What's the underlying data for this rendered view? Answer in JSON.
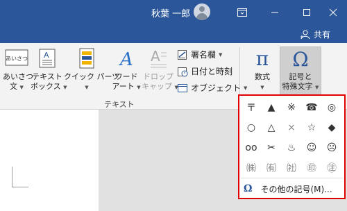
{
  "titlebar": {
    "user_name": "秋葉 一郎"
  },
  "sharebar": {
    "share_label": "共有"
  },
  "ribbon": {
    "buttons": {
      "greeting": [
        "あいさつ",
        "文"
      ],
      "textbox": [
        "テキスト",
        "ボックス"
      ],
      "quickparts": [
        "クイック パーツ"
      ],
      "wordart": [
        "ワード",
        "アート"
      ],
      "dropcap": [
        "ドロップ",
        "キャップ"
      ],
      "equation": [
        "数式"
      ],
      "symbol": [
        "記号と",
        "特殊文字"
      ]
    },
    "greeting_icon_text": "あいさつ",
    "small": {
      "signature": "署名欄",
      "datetime": "日付と時刻",
      "object": "オブジェクト"
    },
    "group_label": "テキスト"
  },
  "dropdown": {
    "symbols": [
      [
        "〒",
        "▲",
        "※",
        "☎",
        "◎"
      ],
      [
        "○",
        "△",
        "×",
        "☆",
        "◆"
      ],
      [
        "oo",
        "✂",
        "♨",
        "☺",
        "☹"
      ],
      [
        "㈱",
        "㈲",
        "㈳",
        "㊞",
        "㊟"
      ]
    ],
    "more_label": "その他の記号(M)..."
  }
}
